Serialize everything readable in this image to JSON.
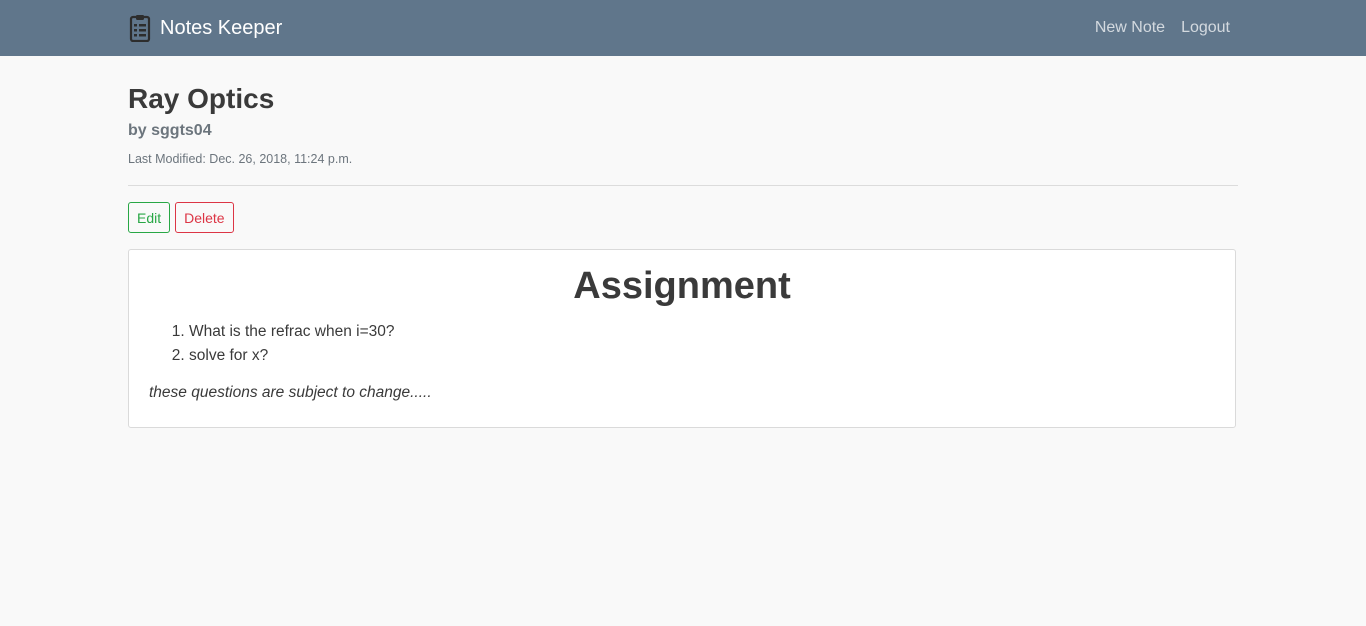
{
  "navbar": {
    "brand_label": "Notes Keeper",
    "brand_icon": "clipboard-icon",
    "links": [
      "New Note",
      "Logout"
    ]
  },
  "note": {
    "title": "Ray Optics",
    "author": "by sggts04",
    "last_modified": "Last Modified: Dec. 26, 2018, 11:24 p.m."
  },
  "actions": {
    "edit_label": "Edit",
    "delete_label": "Delete"
  },
  "card": {
    "heading": "Assignment",
    "items": [
      "What is the refrac when i=30?",
      "solve for x?"
    ],
    "footnote": "these questions are subject to change....."
  },
  "colors": {
    "navbar": "#60768b",
    "edit": "#28a745",
    "delete": "#dc3545",
    "background": "#f9f9f9"
  }
}
